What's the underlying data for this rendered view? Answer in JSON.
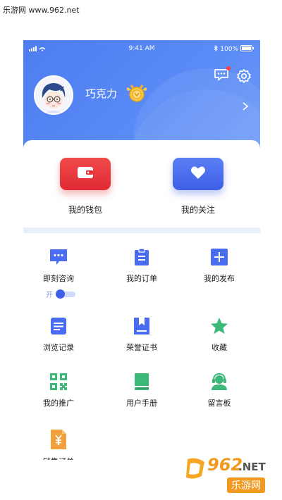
{
  "watermark": {
    "top_text": "乐游网 www.962.net",
    "logo_main": "962",
    "logo_suffix": ".NET",
    "logo_sub": "乐游网"
  },
  "status_bar": {
    "time": "9:41 AM",
    "battery": "100%"
  },
  "profile": {
    "username": "巧克力"
  },
  "quick_actions": [
    {
      "label": "我的钱包",
      "color": "#e53238"
    },
    {
      "label": "我的关注",
      "color": "#4a6cf0"
    }
  ],
  "menu": [
    {
      "label": "即刻咨询",
      "icon": "chat-bubble-icon"
    },
    {
      "label": "我的订单",
      "icon": "clipboard-icon"
    },
    {
      "label": "我的发布",
      "icon": "plus-square-icon"
    },
    {
      "label": "浏览记录",
      "icon": "document-icon"
    },
    {
      "label": "荣誉证书",
      "icon": "certificate-icon"
    },
    {
      "label": "收藏",
      "icon": "star-icon"
    },
    {
      "label": "我的推广",
      "icon": "qr-code-icon"
    },
    {
      "label": "用户手册",
      "icon": "book-icon"
    },
    {
      "label": "留言板",
      "icon": "headset-icon"
    },
    {
      "label": "销售订单",
      "icon": "yuan-document-icon"
    }
  ],
  "consult_toggle": {
    "state_label": "开",
    "on": true
  },
  "colors": {
    "header_blue": "#5a8bf6",
    "accent_blue": "#4a6cf0",
    "green": "#3cb878",
    "orange": "#f0a03c"
  }
}
